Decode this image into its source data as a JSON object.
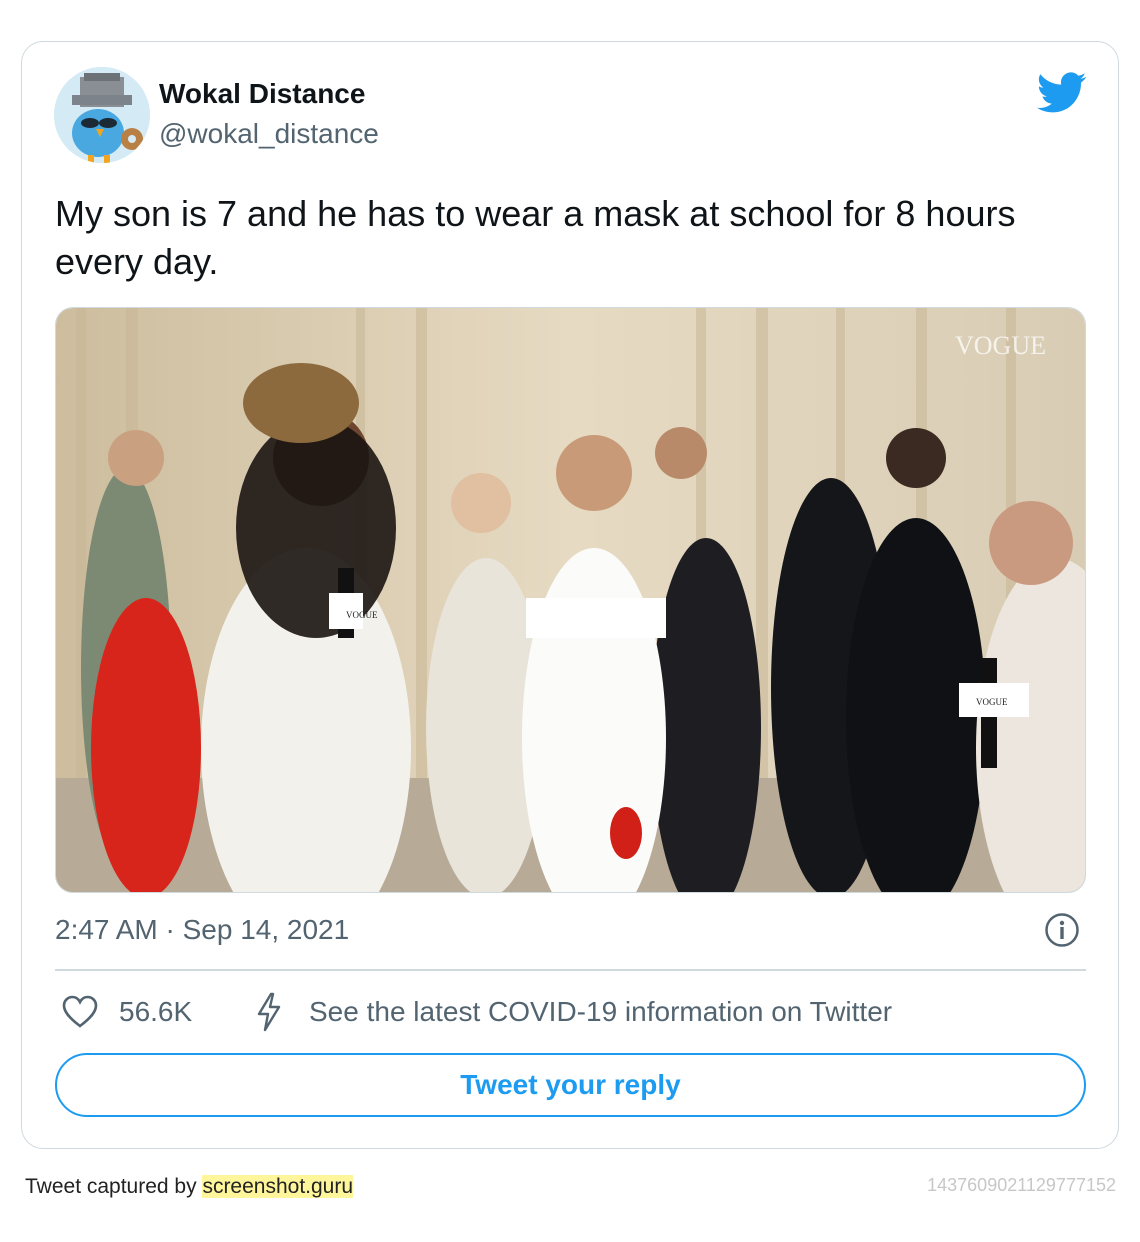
{
  "tweet": {
    "author_name": "Wokal Distance",
    "author_handle": "@wokal_distance",
    "text": "My son is 7 and he has to wear a mask at school for 8 hours every day.",
    "timestamp": "2:47 AM · Sep 14, 2021",
    "like_count": "56.6K",
    "covid_notice": "See the latest COVID-19 information on Twitter",
    "reply_button_label": "Tweet your reply",
    "media_watermark": "VOGUE",
    "mic_flag_label": "VOGUE"
  },
  "footer": {
    "captured_prefix": "Tweet captured by ",
    "captured_by": "screenshot.guru",
    "tweet_id": "1437609021129777152"
  },
  "icons": {
    "brand": "twitter-bird-icon",
    "info": "info-icon",
    "like": "heart-icon",
    "covid": "lightning-bolt-icon"
  },
  "colors": {
    "accent": "#1d9bf0",
    "secondary_text": "#536471",
    "border": "#cfd9de",
    "highlight": "#fff59a"
  }
}
